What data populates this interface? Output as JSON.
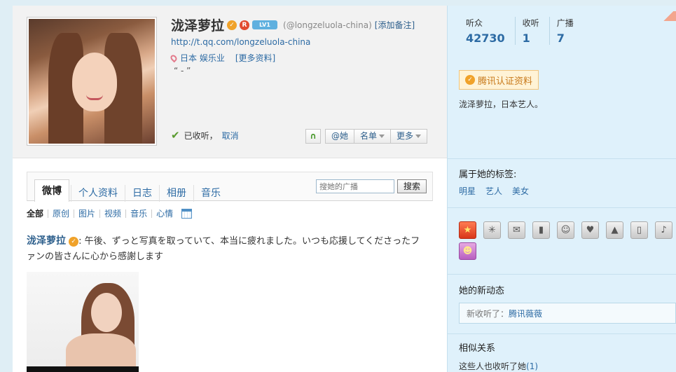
{
  "profile": {
    "name": "泷泽萝拉",
    "handle": "(@longzeluola-china)",
    "add_remark": "[添加备注]",
    "level_badge": "LV1",
    "url": "http://t.qq.com/longzeluola-china",
    "location": "日本 娱乐业",
    "more_info": "[更多资料]",
    "quote": "“ - ”",
    "follow_status": "已收听，",
    "cancel": "取消"
  },
  "actions": {
    "mention": "@她",
    "list": "名单",
    "more": "更多"
  },
  "tabs": [
    {
      "label": "微博"
    },
    {
      "label": "个人资料"
    },
    {
      "label": "日志"
    },
    {
      "label": "相册"
    },
    {
      "label": "音乐"
    }
  ],
  "search": {
    "placeholder": "搜她的广播",
    "button": "搜索"
  },
  "filters": [
    "全部",
    "原创",
    "图片",
    "视频",
    "音乐",
    "心情"
  ],
  "post": {
    "author": "泷泽萝拉",
    "text": "午後、ずっと写真を取っていて、本当に疲れました。いつも応援してくださったファンの皆さんに心から感謝します"
  },
  "stats": [
    {
      "label": "听众",
      "value": "42730"
    },
    {
      "label": "收听",
      "value": "1"
    },
    {
      "label": "广播",
      "value": "7"
    }
  ],
  "sidebar": {
    "verify_label": "腾讯认证资料",
    "verify_desc": "泷泽萝拉，日本艺人。",
    "tags_title": "属于她的标签:",
    "tags": [
      "明星",
      "艺人",
      "美女"
    ],
    "icons": [
      {
        "name": "qzone-icon",
        "glyph": "★"
      },
      {
        "name": "pengyou-icon",
        "glyph": "✳"
      },
      {
        "name": "qqmail-icon",
        "glyph": "✉"
      },
      {
        "name": "reader-icon",
        "glyph": "▮"
      },
      {
        "name": "qqpet-icon",
        "glyph": "☺"
      },
      {
        "name": "qqshow-icon",
        "glyph": "♥"
      },
      {
        "name": "photo-icon",
        "glyph": "▲"
      },
      {
        "name": "mobile-icon",
        "glyph": "▯"
      },
      {
        "name": "mic-icon",
        "glyph": "♪"
      },
      {
        "name": "qqgame-icon",
        "glyph": "☻"
      }
    ],
    "news_title": "她的新动态",
    "news_prefix": "新收听了：",
    "news_link": "腾讯薇薇",
    "similar_title": "相似关系",
    "similar_text": "这些人也收听了她",
    "similar_count": "(1)"
  }
}
